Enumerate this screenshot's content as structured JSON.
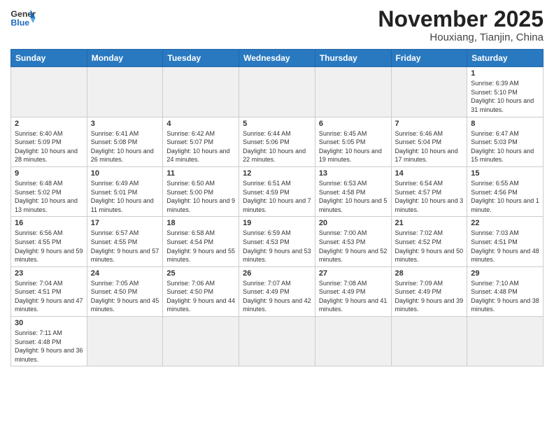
{
  "header": {
    "logo_general": "General",
    "logo_blue": "Blue",
    "title": "November 2025",
    "location": "Houxiang, Tianjin, China"
  },
  "weekdays": [
    "Sunday",
    "Monday",
    "Tuesday",
    "Wednesday",
    "Thursday",
    "Friday",
    "Saturday"
  ],
  "weeks": [
    [
      {
        "day": "",
        "info": ""
      },
      {
        "day": "",
        "info": ""
      },
      {
        "day": "",
        "info": ""
      },
      {
        "day": "",
        "info": ""
      },
      {
        "day": "",
        "info": ""
      },
      {
        "day": "",
        "info": ""
      },
      {
        "day": "1",
        "info": "Sunrise: 6:39 AM\nSunset: 5:10 PM\nDaylight: 10 hours and 31 minutes."
      }
    ],
    [
      {
        "day": "2",
        "info": "Sunrise: 6:40 AM\nSunset: 5:09 PM\nDaylight: 10 hours and 28 minutes."
      },
      {
        "day": "3",
        "info": "Sunrise: 6:41 AM\nSunset: 5:08 PM\nDaylight: 10 hours and 26 minutes."
      },
      {
        "day": "4",
        "info": "Sunrise: 6:42 AM\nSunset: 5:07 PM\nDaylight: 10 hours and 24 minutes."
      },
      {
        "day": "5",
        "info": "Sunrise: 6:44 AM\nSunset: 5:06 PM\nDaylight: 10 hours and 22 minutes."
      },
      {
        "day": "6",
        "info": "Sunrise: 6:45 AM\nSunset: 5:05 PM\nDaylight: 10 hours and 19 minutes."
      },
      {
        "day": "7",
        "info": "Sunrise: 6:46 AM\nSunset: 5:04 PM\nDaylight: 10 hours and 17 minutes."
      },
      {
        "day": "8",
        "info": "Sunrise: 6:47 AM\nSunset: 5:03 PM\nDaylight: 10 hours and 15 minutes."
      }
    ],
    [
      {
        "day": "9",
        "info": "Sunrise: 6:48 AM\nSunset: 5:02 PM\nDaylight: 10 hours and 13 minutes."
      },
      {
        "day": "10",
        "info": "Sunrise: 6:49 AM\nSunset: 5:01 PM\nDaylight: 10 hours and 11 minutes."
      },
      {
        "day": "11",
        "info": "Sunrise: 6:50 AM\nSunset: 5:00 PM\nDaylight: 10 hours and 9 minutes."
      },
      {
        "day": "12",
        "info": "Sunrise: 6:51 AM\nSunset: 4:59 PM\nDaylight: 10 hours and 7 minutes."
      },
      {
        "day": "13",
        "info": "Sunrise: 6:53 AM\nSunset: 4:58 PM\nDaylight: 10 hours and 5 minutes."
      },
      {
        "day": "14",
        "info": "Sunrise: 6:54 AM\nSunset: 4:57 PM\nDaylight: 10 hours and 3 minutes."
      },
      {
        "day": "15",
        "info": "Sunrise: 6:55 AM\nSunset: 4:56 PM\nDaylight: 10 hours and 1 minute."
      }
    ],
    [
      {
        "day": "16",
        "info": "Sunrise: 6:56 AM\nSunset: 4:55 PM\nDaylight: 9 hours and 59 minutes."
      },
      {
        "day": "17",
        "info": "Sunrise: 6:57 AM\nSunset: 4:55 PM\nDaylight: 9 hours and 57 minutes."
      },
      {
        "day": "18",
        "info": "Sunrise: 6:58 AM\nSunset: 4:54 PM\nDaylight: 9 hours and 55 minutes."
      },
      {
        "day": "19",
        "info": "Sunrise: 6:59 AM\nSunset: 4:53 PM\nDaylight: 9 hours and 53 minutes."
      },
      {
        "day": "20",
        "info": "Sunrise: 7:00 AM\nSunset: 4:53 PM\nDaylight: 9 hours and 52 minutes."
      },
      {
        "day": "21",
        "info": "Sunrise: 7:02 AM\nSunset: 4:52 PM\nDaylight: 9 hours and 50 minutes."
      },
      {
        "day": "22",
        "info": "Sunrise: 7:03 AM\nSunset: 4:51 PM\nDaylight: 9 hours and 48 minutes."
      }
    ],
    [
      {
        "day": "23",
        "info": "Sunrise: 7:04 AM\nSunset: 4:51 PM\nDaylight: 9 hours and 47 minutes."
      },
      {
        "day": "24",
        "info": "Sunrise: 7:05 AM\nSunset: 4:50 PM\nDaylight: 9 hours and 45 minutes."
      },
      {
        "day": "25",
        "info": "Sunrise: 7:06 AM\nSunset: 4:50 PM\nDaylight: 9 hours and 44 minutes."
      },
      {
        "day": "26",
        "info": "Sunrise: 7:07 AM\nSunset: 4:49 PM\nDaylight: 9 hours and 42 minutes."
      },
      {
        "day": "27",
        "info": "Sunrise: 7:08 AM\nSunset: 4:49 PM\nDaylight: 9 hours and 41 minutes."
      },
      {
        "day": "28",
        "info": "Sunrise: 7:09 AM\nSunset: 4:49 PM\nDaylight: 9 hours and 39 minutes."
      },
      {
        "day": "29",
        "info": "Sunrise: 7:10 AM\nSunset: 4:48 PM\nDaylight: 9 hours and 38 minutes."
      }
    ],
    [
      {
        "day": "30",
        "info": "Sunrise: 7:11 AM\nSunset: 4:48 PM\nDaylight: 9 hours and 36 minutes."
      },
      {
        "day": "",
        "info": ""
      },
      {
        "day": "",
        "info": ""
      },
      {
        "day": "",
        "info": ""
      },
      {
        "day": "",
        "info": ""
      },
      {
        "day": "",
        "info": ""
      },
      {
        "day": "",
        "info": ""
      }
    ]
  ]
}
